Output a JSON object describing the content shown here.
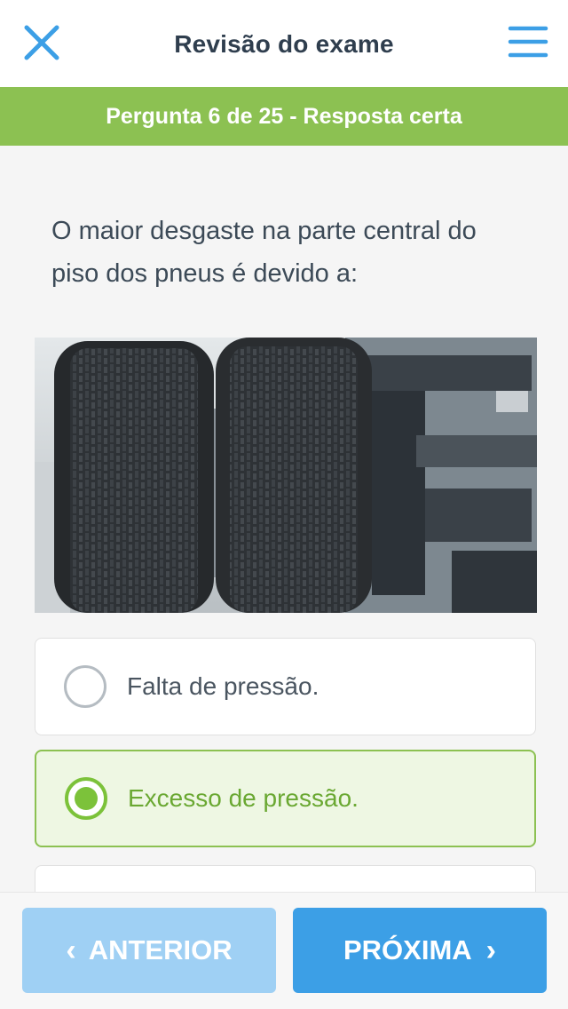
{
  "header": {
    "title": "Revisão do exame",
    "close_icon": "close-icon",
    "menu_icon": "hamburger-menu-icon",
    "accent_color": "#3c9fe6"
  },
  "status": {
    "text": "Pergunta 6 de 25 - Resposta certa",
    "color": "#8cc152"
  },
  "question": {
    "text": "O maior desgaste na parte central do piso dos pneus é devido a:",
    "image": "truck-dual-tires-photo"
  },
  "options": [
    {
      "label": "Falta de pressão.",
      "selected": false
    },
    {
      "label": "Excesso de pressão.",
      "selected": true
    },
    {
      "label": "",
      "selected": false
    }
  ],
  "footer": {
    "prev_label": "ANTERIOR",
    "next_label": "PRÓXIMA",
    "prev_icon": "chevron-left-icon",
    "next_icon": "chevron-right-icon"
  }
}
